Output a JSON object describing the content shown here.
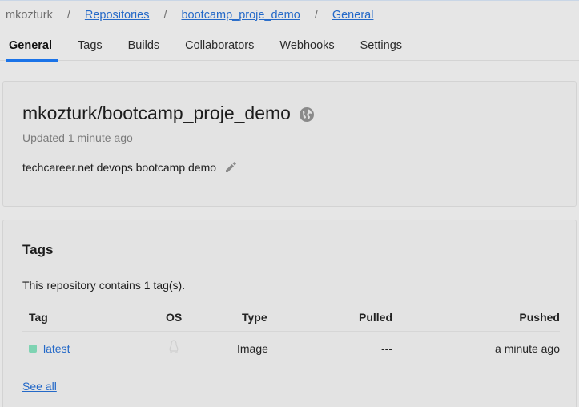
{
  "breadcrumb": {
    "user": "mkozturk",
    "repositories": "Repositories",
    "repo": "bootcamp_proje_demo",
    "current": "General",
    "separator": "/"
  },
  "tabs": [
    {
      "label": "General",
      "active": true
    },
    {
      "label": "Tags",
      "active": false
    },
    {
      "label": "Builds",
      "active": false
    },
    {
      "label": "Collaborators",
      "active": false
    },
    {
      "label": "Webhooks",
      "active": false
    },
    {
      "label": "Settings",
      "active": false
    }
  ],
  "repo": {
    "title": "mkozturk/bootcamp_proje_demo",
    "visibility_icon": "globe-icon",
    "updated": "Updated 1 minute ago",
    "description": "techcareer.net devops bootcamp demo"
  },
  "tags": {
    "title": "Tags",
    "count_text": "This repository contains 1 tag(s).",
    "columns": [
      "Tag",
      "OS",
      "Type",
      "Pulled",
      "Pushed"
    ],
    "rows": [
      {
        "tag": "latest",
        "os_icon": "linux-icon",
        "type": "Image",
        "pulled": "---",
        "pushed": "a minute ago"
      }
    ],
    "see_all": "See all"
  },
  "colors": {
    "accent": "#1a73e8",
    "link": "#2469c8",
    "tag_status": "#7ed3b2",
    "background": "#e6e6e6"
  }
}
